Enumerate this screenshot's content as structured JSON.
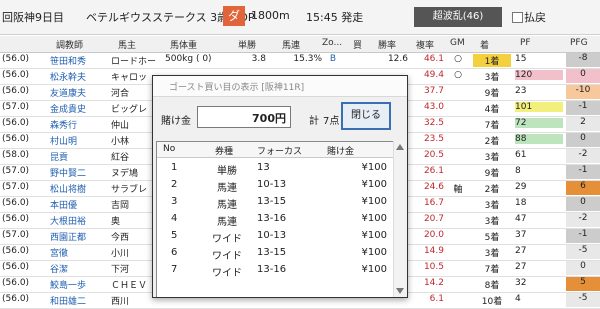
{
  "header": {
    "race": "回阪神9日目",
    "race_name": "ベテルギウスステークス 3歳上OP",
    "surface": "ダ",
    "distance": "1800m",
    "start_time": "15:45 発走",
    "chaos_badge": "超波乱(46)",
    "exclude_label": "払戻"
  },
  "table": {
    "columns": [
      "調教師",
      "馬主",
      "馬体重",
      "単勝",
      "馬連",
      "Zo...",
      "買",
      "勝率",
      "複率",
      "GM",
      "着",
      "PF",
      "PFG"
    ],
    "rows": [
      {
        "weight": "(56.0)",
        "jockey": "笹田和秀",
        "owner": "ロードホー",
        "body": "500kg ( 0)",
        "tan": "3.8",
        "uma": "15.3%",
        "zo": "B",
        "kai": "",
        "rate": "12.6",
        "fuk": "46.1",
        "gm": "○",
        "chaku": "1着",
        "pf": "15",
        "pfg": "-8",
        "chaku_color": "#f4d03f",
        "pf_color": "#ffffff",
        "pfg_color": "#cccccc"
      },
      {
        "weight": "(56.0)",
        "jockey": "松永幹夫",
        "owner": "キャロッ",
        "body": "",
        "tan": "",
        "uma": "",
        "zo": "",
        "kai": "",
        "rate": "",
        "fuk": "49.4",
        "gm": "○",
        "chaku": "3着",
        "pf": "120",
        "pfg": "0",
        "chaku_color": "#ffffff",
        "pf_color": "#f2c0cb",
        "pfg_color": "#f2c0cb"
      },
      {
        "weight": "(56.0)",
        "jockey": "友道康夫",
        "owner": "河合",
        "body": "",
        "tan": "",
        "uma": "",
        "zo": "",
        "kai": "",
        "rate": "",
        "fuk": "37.7",
        "gm": "",
        "chaku": "9着",
        "pf": "23",
        "pfg": "-10",
        "chaku_color": "#ffffff",
        "pf_color": "#ffffff",
        "pfg_color": "#f7c89b"
      },
      {
        "weight": "(57.0)",
        "jockey": "金成貴史",
        "owner": "ビッグレ",
        "body": "",
        "tan": "",
        "uma": "",
        "zo": "",
        "kai": "",
        "rate": "",
        "fuk": "43.0",
        "gm": "",
        "chaku": "4着",
        "pf": "101",
        "pfg": "-1",
        "chaku_color": "#ffffff",
        "pf_color": "#f3ef7c",
        "pfg_color": "#cccccc"
      },
      {
        "weight": "(56.0)",
        "jockey": "森秀行",
        "owner": "仲山",
        "body": "",
        "tan": "",
        "uma": "",
        "zo": "",
        "kai": "",
        "rate": "",
        "fuk": "32.5",
        "gm": "",
        "chaku": "7着",
        "pf": "72",
        "pfg": "2",
        "chaku_color": "#ffffff",
        "pf_color": "#bde5bd",
        "pfg_color": "#e8e8e8"
      },
      {
        "weight": "(56.0)",
        "jockey": "村山明",
        "owner": "小林",
        "body": "",
        "tan": "",
        "uma": "",
        "zo": "",
        "kai": "",
        "rate": "",
        "fuk": "23.5",
        "gm": "",
        "chaku": "2着",
        "pf": "88",
        "pfg": "0",
        "chaku_color": "#ffffff",
        "pf_color": "#bde5bd",
        "pfg_color": "#cccccc"
      },
      {
        "weight": "(58.0)",
        "jockey": "昆貢",
        "owner": "紅谷",
        "body": "",
        "tan": "",
        "uma": "",
        "zo": "",
        "kai": "",
        "rate": "",
        "fuk": "20.5",
        "gm": "",
        "chaku": "3着",
        "pf": "61",
        "pfg": "-2",
        "chaku_color": "#ffffff",
        "pf_color": "#ffffff",
        "pfg_color": "#e8e8e8"
      },
      {
        "weight": "(57.0)",
        "jockey": "野中賢二",
        "owner": "ヌデ鳩",
        "body": "",
        "tan": "",
        "uma": "",
        "zo": "",
        "kai": "",
        "rate": "",
        "fuk": "26.1",
        "gm": "",
        "chaku": "9着",
        "pf": "8",
        "pfg": "-1",
        "chaku_color": "#ffffff",
        "pf_color": "#ffffff",
        "pfg_color": "#cccccc"
      },
      {
        "weight": "(57.0)",
        "jockey": "松山将樹",
        "owner": "サラブレ",
        "body": "",
        "tan": "",
        "uma": "",
        "zo": "",
        "kai": "",
        "rate": "",
        "fuk": "24.6",
        "gm": "軸",
        "chaku": "2着",
        "pf": "29",
        "pfg": "6",
        "chaku_color": "#ffffff",
        "pf_color": "#ffffff",
        "pfg_color": "#e59039"
      },
      {
        "weight": "(56.0)",
        "jockey": "本田優",
        "owner": "吉岡",
        "body": "",
        "tan": "",
        "uma": "",
        "zo": "",
        "kai": "",
        "rate": "",
        "fuk": "16.7",
        "gm": "",
        "chaku": "3着",
        "pf": "18",
        "pfg": "0",
        "chaku_color": "#ffffff",
        "pf_color": "#ffffff",
        "pfg_color": "#cccccc"
      },
      {
        "weight": "(56.0)",
        "jockey": "大根田裕",
        "owner": "奥",
        "body": "",
        "tan": "",
        "uma": "",
        "zo": "",
        "kai": "",
        "rate": "",
        "fuk": "20.7",
        "gm": "",
        "chaku": "3着",
        "pf": "47",
        "pfg": "-2",
        "chaku_color": "#ffffff",
        "pf_color": "#ffffff",
        "pfg_color": "#e8e8e8"
      },
      {
        "weight": "(57.0)",
        "jockey": "西園正都",
        "owner": "今西",
        "body": "",
        "tan": "",
        "uma": "",
        "zo": "",
        "kai": "",
        "rate": "",
        "fuk": "20.0",
        "gm": "",
        "chaku": "5着",
        "pf": "37",
        "pfg": "-1",
        "chaku_color": "#ffffff",
        "pf_color": "#ffffff",
        "pfg_color": "#cccccc"
      },
      {
        "weight": "(56.0)",
        "jockey": "宮徹",
        "owner": "小川",
        "body": "",
        "tan": "",
        "uma": "",
        "zo": "",
        "kai": "",
        "rate": "",
        "fuk": "14.9",
        "gm": "",
        "chaku": "3着",
        "pf": "27",
        "pfg": "-5",
        "chaku_color": "#ffffff",
        "pf_color": "#ffffff",
        "pfg_color": "#e8e8e8"
      },
      {
        "weight": "(56.0)",
        "jockey": "谷潔",
        "owner": "下河",
        "body": "",
        "tan": "",
        "uma": "",
        "zo": "",
        "kai": "",
        "rate": "",
        "fuk": "10.5",
        "gm": "",
        "chaku": "7着",
        "pf": "27",
        "pfg": "0",
        "chaku_color": "#ffffff",
        "pf_color": "#ffffff",
        "pfg_color": "#e8e8e8"
      },
      {
        "weight": "(56.0)",
        "jockey": "鮫島一歩",
        "owner": "ＣＨＥＶ",
        "body": "",
        "tan": "",
        "uma": "",
        "zo": "",
        "kai": "",
        "rate": "",
        "fuk": "14.2",
        "gm": "",
        "chaku": "8着",
        "pf": "32",
        "pfg": "5",
        "chaku_color": "#ffffff",
        "pf_color": "#ffffff",
        "pfg_color": "#e59039"
      },
      {
        "weight": "(56.0)",
        "jockey": "和田雄二",
        "owner": "西川",
        "body": "",
        "tan": "",
        "uma": "",
        "zo": "",
        "kai": "",
        "rate": "",
        "fuk": "6.1",
        "gm": "",
        "chaku": "10着",
        "pf": "4",
        "pfg": "-5",
        "chaku_color": "#ffffff",
        "pf_color": "#ffffff",
        "pfg_color": "#e8e8e8"
      }
    ]
  },
  "dialog": {
    "title": "ゴースト買い目の表示 [阪神11R]",
    "amount_label": "賭け金",
    "amount_value": "700円",
    "total_label": "計",
    "total_value": "7点",
    "close_label": "閉じる",
    "columns": [
      "No",
      "券種",
      "フォーカス",
      "賭け金"
    ],
    "bets": [
      {
        "no": "1",
        "type": "単勝",
        "combo": "13",
        "amount": "¥100"
      },
      {
        "no": "2",
        "type": "馬連",
        "combo": "10-13",
        "amount": "¥100"
      },
      {
        "no": "3",
        "type": "馬連",
        "combo": "13-15",
        "amount": "¥100"
      },
      {
        "no": "4",
        "type": "馬連",
        "combo": "13-16",
        "amount": "¥100"
      },
      {
        "no": "5",
        "type": "ワイド",
        "combo": "10-13",
        "amount": "¥100"
      },
      {
        "no": "6",
        "type": "ワイド",
        "combo": "13-15",
        "amount": "¥100"
      },
      {
        "no": "7",
        "type": "ワイド",
        "combo": "13-16",
        "amount": "¥100"
      }
    ]
  }
}
